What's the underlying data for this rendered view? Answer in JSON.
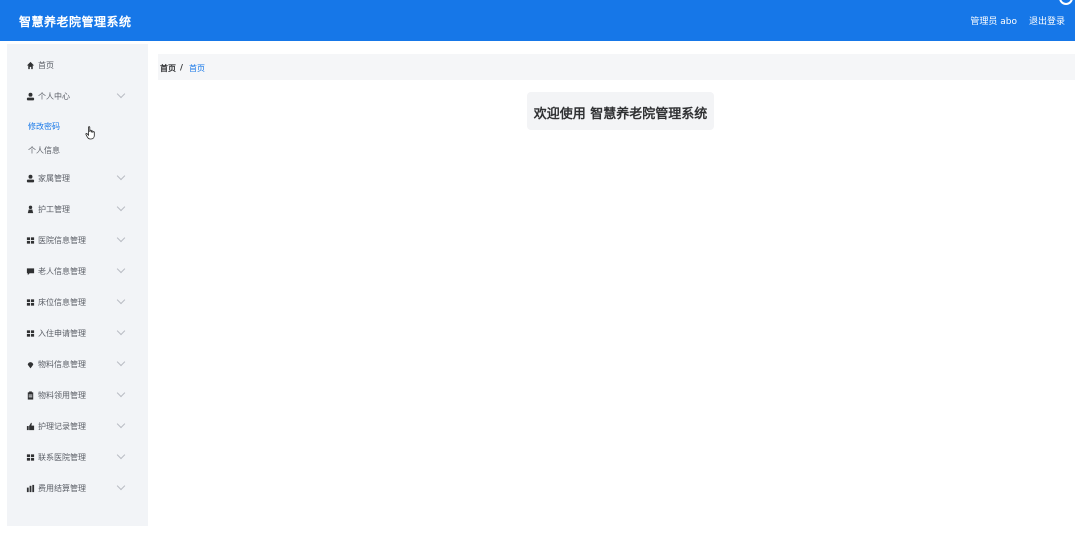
{
  "header": {
    "logo": "智慧养老院管理系统",
    "user": "管理员 abo",
    "logout": "退出登录"
  },
  "sidebar": {
    "items": [
      {
        "label": "首页",
        "icon": "home-icon",
        "expandable": false
      },
      {
        "label": "个人中心",
        "icon": "user-icon",
        "expandable": true,
        "expanded": true,
        "children": [
          {
            "label": "修改密码",
            "active": true
          },
          {
            "label": "个人信息",
            "active": false
          }
        ]
      },
      {
        "label": "家属管理",
        "icon": "user-icon",
        "expandable": true
      },
      {
        "label": "护工管理",
        "icon": "person-icon",
        "expandable": true
      },
      {
        "label": "医院信息管理",
        "icon": "grid-icon",
        "expandable": true
      },
      {
        "label": "老人信息管理",
        "icon": "message-icon",
        "expandable": true
      },
      {
        "label": "床位信息管理",
        "icon": "grid-icon",
        "expandable": true
      },
      {
        "label": "入住申请管理",
        "icon": "grid-icon",
        "expandable": true
      },
      {
        "label": "物料信息管理",
        "icon": "location-icon",
        "expandable": true
      },
      {
        "label": "物料领用管理",
        "icon": "clipboard-icon",
        "expandable": true
      },
      {
        "label": "护理记录管理",
        "icon": "thumb-icon",
        "expandable": true
      },
      {
        "label": "联系医院管理",
        "icon": "grid-icon",
        "expandable": true
      },
      {
        "label": "费用结算管理",
        "icon": "chart-icon",
        "expandable": true
      }
    ]
  },
  "breadcrumb": {
    "home": "首页",
    "separator": "/",
    "current": "首页"
  },
  "main": {
    "welcome": "欢迎使用 智慧养老院管理系统"
  },
  "colors": {
    "primary": "#1677e8",
    "sidebar_bg": "#f2f4f7",
    "text": "#303133",
    "muted_text": "#5a5e66"
  }
}
